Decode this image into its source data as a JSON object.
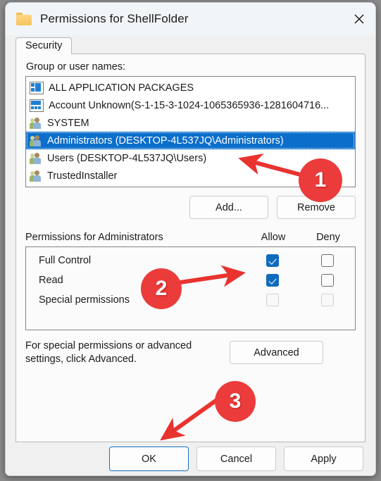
{
  "window": {
    "title": "Permissions for ShellFolder",
    "folder_icon": "folder-icon",
    "close_icon": "close-icon"
  },
  "tabs": [
    {
      "label": "Security",
      "active": true
    }
  ],
  "group_section": {
    "label": "Group or user names:",
    "items": [
      {
        "name": "ALL APPLICATION PACKAGES",
        "icon": "app-package-icon",
        "selected": false
      },
      {
        "name": "Account Unknown(S-1-15-3-1024-1065365936-1281604716...",
        "icon": "app-package-icon",
        "selected": false
      },
      {
        "name": "SYSTEM",
        "icon": "group-icon",
        "selected": false
      },
      {
        "name": "Administrators (DESKTOP-4L537JQ\\Administrators)",
        "icon": "group-icon",
        "selected": true
      },
      {
        "name": "Users (DESKTOP-4L537JQ\\Users)",
        "icon": "group-icon",
        "selected": false
      },
      {
        "name": "TrustedInstaller",
        "icon": "group-icon",
        "selected": false
      }
    ],
    "add_label": "Add...",
    "remove_label": "Remove"
  },
  "permissions_section": {
    "title": "Permissions for Administrators",
    "allow_header": "Allow",
    "deny_header": "Deny",
    "rows": [
      {
        "name": "Full Control",
        "allow": true,
        "deny": false,
        "disabled": false
      },
      {
        "name": "Read",
        "allow": true,
        "deny": false,
        "disabled": false
      },
      {
        "name": "Special permissions",
        "allow": false,
        "deny": false,
        "disabled": true
      }
    ]
  },
  "advanced_section": {
    "note": "For special permissions or advanced settings, click Advanced.",
    "button_label": "Advanced"
  },
  "footer": {
    "ok_label": "OK",
    "cancel_label": "Cancel",
    "apply_label": "Apply"
  },
  "annotations": {
    "accent_color": "#eb3b3b",
    "badges": [
      {
        "number": "1",
        "target": "selected-group-row"
      },
      {
        "number": "2",
        "target": "allow-checkboxes"
      },
      {
        "number": "3",
        "target": "ok-button"
      }
    ]
  },
  "colors": {
    "selection_blue": "#0b6ecb",
    "checkbox_blue": "#0f6cbd",
    "focus_border": "#1670c1",
    "titlebar": "#f2f5f7",
    "dialog_bg": "#f0f0f0"
  }
}
